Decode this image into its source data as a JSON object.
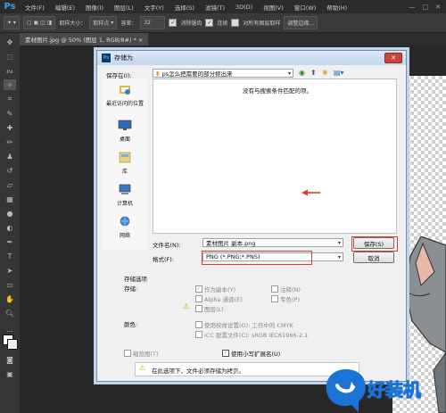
{
  "menubar": {
    "logo": "Ps",
    "items": [
      "文件(F)",
      "编辑(E)",
      "图像(I)",
      "图层(L)",
      "文字(Y)",
      "选择(S)",
      "滤镜(T)",
      "3D(D)",
      "视图(V)",
      "窗口(W)",
      "帮助(H)"
    ],
    "window_buttons": [
      "—",
      "□",
      "✕"
    ]
  },
  "optionsbar": {
    "sample_size_label": "取样大小：",
    "sample_size_value": "取样点",
    "tolerance_label": "容差：",
    "tolerance_value": "32",
    "antialias": "消除锯齿",
    "contiguous": "连续",
    "sample_all_layers": "对所有图层取样",
    "refine_edge": "调整边缘..."
  },
  "document_tab": "素材图片.jpg @ 50% (图层 1, RGB/8#) * ×",
  "dialog": {
    "title": "存储为",
    "save_in_label": "保存在(I):",
    "save_in_value": "ps怎么把需要的部分抠出来",
    "empty_message": "没有与搜索条件匹配的项。",
    "places": [
      {
        "label": "最近访问的位置",
        "icon": "recent-places-icon"
      },
      {
        "label": "桌面",
        "icon": "desktop-icon"
      },
      {
        "label": "库",
        "icon": "library-icon"
      },
      {
        "label": "计算机",
        "icon": "computer-icon"
      },
      {
        "label": "网络",
        "icon": "network-icon"
      }
    ],
    "filename_label": "文件名(N):",
    "filename_value": "素材图片 副本.png",
    "format_label": "格式(F):",
    "format_value": "PNG (*.PNG;*.PNS)",
    "save_button": "保存(S)",
    "cancel_button": "取消",
    "options_header": "存储选项",
    "storage_label": "存储:",
    "as_copy": "作为副本(Y)",
    "alpha": "Alpha 通道(E)",
    "layers": "图层(L)",
    "notes": "注释(N)",
    "spot_colors": "专色(P)",
    "color_label": "颜色:",
    "use_proof": "使用校样设置(O): 工作中的 CMYK",
    "icc": "ICC 配置文件(C): sRGB IEC61966-2.1",
    "thumbnail": "缩览图(T)",
    "lowercase_ext": "使用小写扩展名(U)",
    "warning": "在此选项下，文件必须存储为拷贝。"
  },
  "watermark": {
    "text": "好装机"
  }
}
